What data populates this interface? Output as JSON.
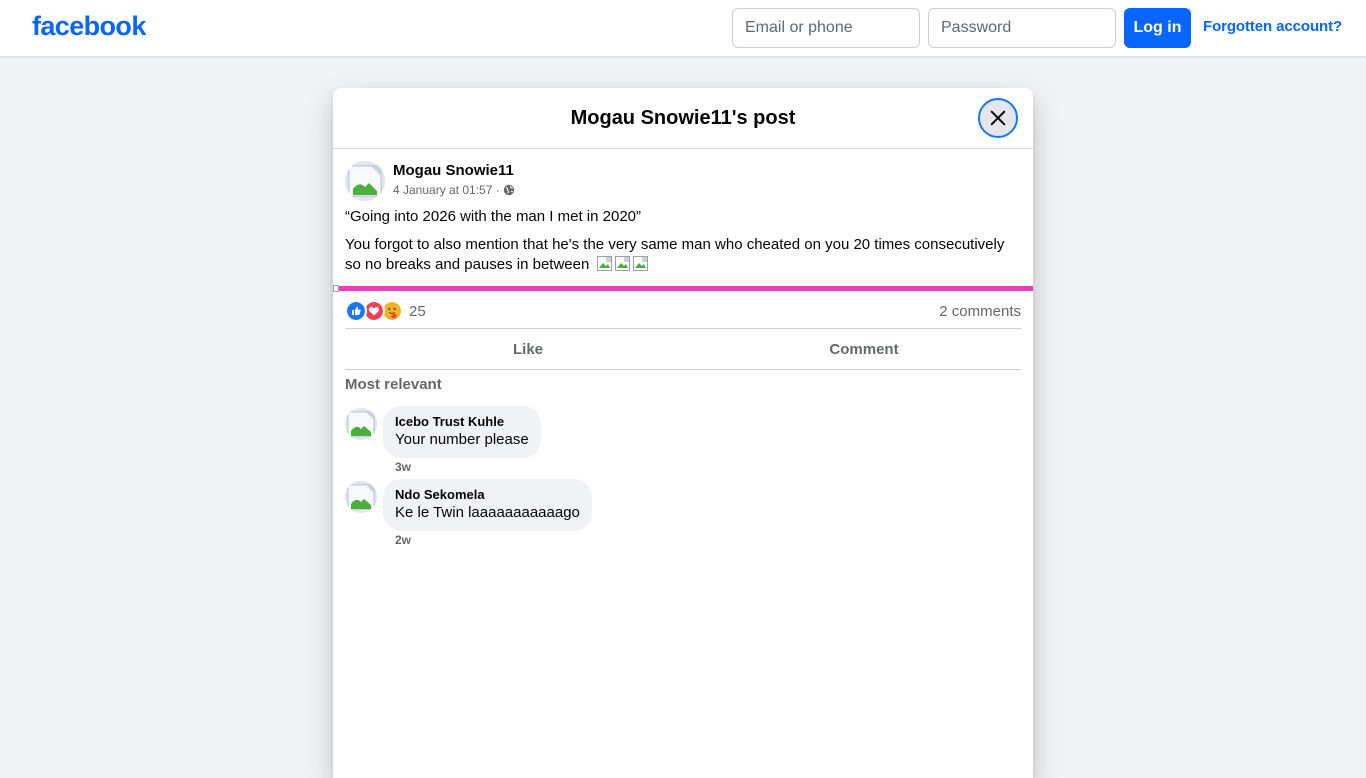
{
  "header": {
    "logo_text": "facebook",
    "email_placeholder": "Email or phone",
    "password_placeholder": "Password",
    "login_label": "Log in",
    "forgot_label": "Forgotten account?",
    "brand_color": "#0866ff"
  },
  "modal": {
    "title": "Mogau Snowie11's post",
    "close_icon": "close-icon"
  },
  "post": {
    "author": "Mogau Snowie11",
    "timestamp": "4 January at 01:57 ·",
    "audience_icon": "globe-icon",
    "quote": "“Going into 2026 with the man I met in 2020”",
    "body": "You forgot to also mention that he's the very same man who cheated on you 20 times consecutively so no breaks and pauses in between",
    "emoji_count": 3,
    "media_color": "#f03cc1",
    "reaction_types": [
      "like",
      "love",
      "care"
    ],
    "reaction_count": "25",
    "comments_count": "2 comments",
    "actions": {
      "like": "Like",
      "comment": "Comment"
    }
  },
  "comments_section": {
    "sort_label": "Most relevant",
    "comments": [
      {
        "author": "Icebo Trust Kuhle",
        "text": "Your number please",
        "time": "3w"
      },
      {
        "author": "Ndo Sekomela",
        "text": "Ke le Twin laaaaaaaaaaago",
        "time": "2w"
      }
    ]
  }
}
